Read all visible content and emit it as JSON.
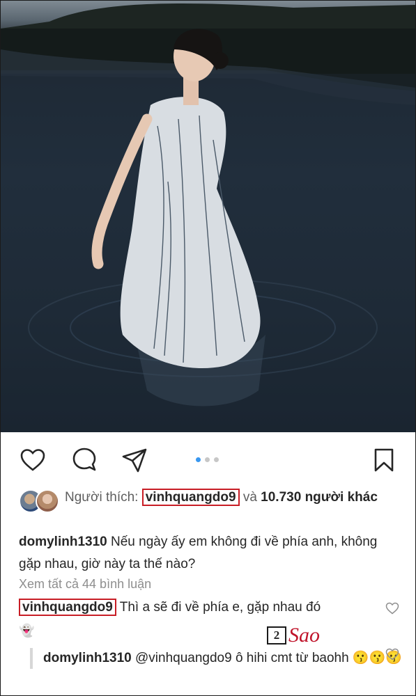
{
  "post": {
    "image_alt": "Woman in a white one-shoulder gown standing in a lake",
    "carousel": {
      "count": 3,
      "active": 1
    }
  },
  "actions": {
    "like_icon": "heart-icon",
    "comment_icon": "comment-icon",
    "share_icon": "paper-plane-icon",
    "save_icon": "bookmark-icon"
  },
  "likes": {
    "prefix": "Người thích: ",
    "user": "vinhquangdo9",
    "joiner": " và ",
    "count_text": "10.730 người khác"
  },
  "caption": {
    "user": "domylinh1310",
    "text": " Nếu ngày ấy em không đi về phía anh, không gặp nhau, giờ này ta thế nào?"
  },
  "view_all": "Xem tất cả 44 bình luận",
  "comment": {
    "user": "vinhquangdo9",
    "text": " Thì a sẽ đi về phía e, gặp nhau đó",
    "emoji": "👻"
  },
  "reply": {
    "user": "domylinh1310",
    "text": " @vinhquangdo9 ô hihi cmt từ baohh 😗😗😗"
  },
  "watermark": {
    "badge": "2",
    "text": "Sao",
    "color": "#c0142b"
  }
}
